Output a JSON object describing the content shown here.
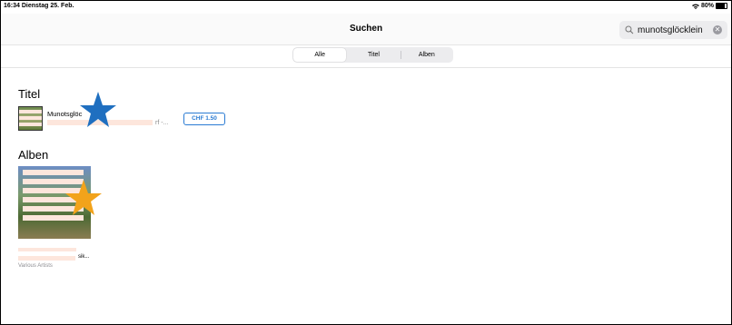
{
  "status_bar": {
    "time": "16:34",
    "date": "Dienstag 25. Feb.",
    "battery": "80%"
  },
  "nav": {
    "title": "Suchen"
  },
  "search": {
    "query": "munotsglöcklein"
  },
  "segments": [
    "Alle",
    "Titel",
    "Alben"
  ],
  "sections": {
    "titel": {
      "heading": "Titel",
      "track": {
        "title": "Munotsglöc",
        "subtitle_tail": "rf -...",
        "price": "CHF 1.50"
      }
    },
    "alben": {
      "heading": "Alben",
      "album": {
        "title_tail": "sik...",
        "artist": "Various Artists"
      }
    }
  },
  "colors": {
    "accent": "#2a7bd3",
    "blue_star": "#1f6fc0",
    "orange_star": "#f2a31b"
  },
  "icons": [
    "wifi-icon",
    "battery-icon",
    "search-icon",
    "clear-icon",
    "star-icon"
  ]
}
